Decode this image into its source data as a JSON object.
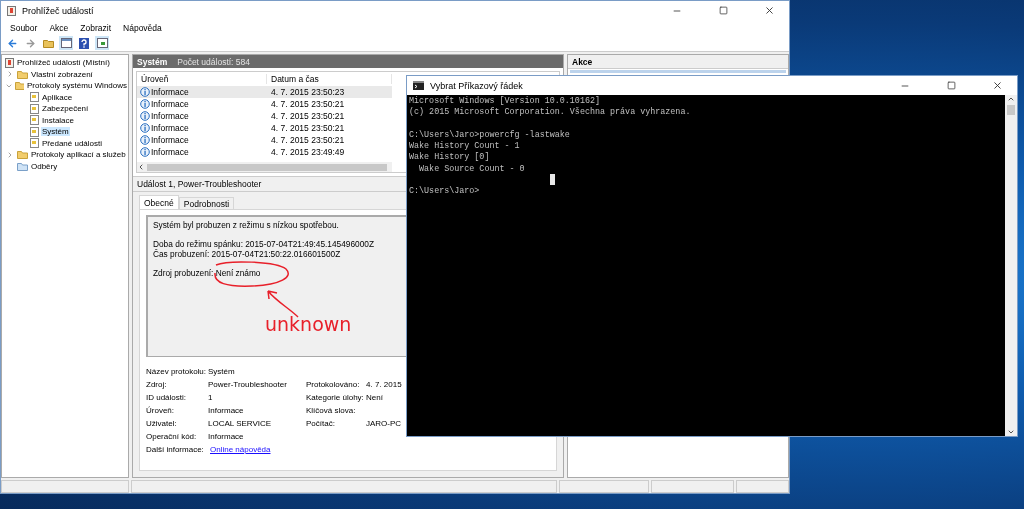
{
  "event_viewer": {
    "title": "Prohlížeč událostí",
    "menu": [
      "Soubor",
      "Akce",
      "Zobrazit",
      "Nápověda"
    ],
    "tree": [
      {
        "label": "Prohlížeč událostí (Místní)",
        "kind": "root",
        "selected": false,
        "children": [
          {
            "label": "Vlastní zobrazení",
            "kind": "folder",
            "expanded": false,
            "selected": false
          },
          {
            "label": "Protokoly systému Windows",
            "kind": "folder",
            "expanded": true,
            "selected": false,
            "children": [
              {
                "label": "Aplikace",
                "kind": "log",
                "selected": false
              },
              {
                "label": "Zabezpečení",
                "kind": "log",
                "selected": false
              },
              {
                "label": "Instalace",
                "kind": "log",
                "selected": false
              },
              {
                "label": "Systém",
                "kind": "log",
                "selected": true
              },
              {
                "label": "Předané události",
                "kind": "log",
                "selected": false
              }
            ]
          },
          {
            "label": "Protokoly aplikací a služeb",
            "kind": "folder",
            "expanded": false,
            "selected": false
          },
          {
            "label": "Odběry",
            "kind": "subscription",
            "selected": false
          }
        ]
      }
    ],
    "log_header": {
      "name": "Systém",
      "count": "Počet událostí: 584"
    },
    "events": {
      "columns": [
        "Úroveň",
        "Datum a čas"
      ],
      "rows": [
        {
          "level": "Informace",
          "time": "4. 7. 2015 23:50:23",
          "selected": true
        },
        {
          "level": "Informace",
          "time": "4. 7. 2015 23:50:21",
          "selected": false
        },
        {
          "level": "Informace",
          "time": "4. 7. 2015 23:50:21",
          "selected": false
        },
        {
          "level": "Informace",
          "time": "4. 7. 2015 23:50:21",
          "selected": false
        },
        {
          "level": "Informace",
          "time": "4. 7. 2015 23:50:21",
          "selected": false
        },
        {
          "level": "Informace",
          "time": "4. 7. 2015 23:49:49",
          "selected": false
        }
      ]
    },
    "detail": {
      "title": "Událost 1, Power-Troubleshooter",
      "tabs": [
        {
          "label": "Obecné",
          "selected": true
        },
        {
          "label": "Podrobnosti",
          "selected": false
        }
      ],
      "message": [
        [
          "Systém byl probuzen z režimu s nízkou spotřebou."
        ],
        [
          "Doba do režimu spánku: 2015-07-04T21:49:45.145496000Z",
          "Čas probuzení: 2015-07-04T21:50:22.016601500Z"
        ],
        [
          "Zdroj probuzení: Není známo"
        ]
      ],
      "annotation": {
        "text": "unknown",
        "color": "#e8202a"
      },
      "properties": [
        {
          "label": "Název protokolu:",
          "value": "Systém",
          "kind": "text"
        },
        {
          "label": "Zdroj:",
          "value": "Power-Troubleshooter",
          "kind": "text",
          "label2": "Protokolováno:",
          "value2": "4. 7. 2015"
        },
        {
          "label": "ID události:",
          "value": "1",
          "kind": "text",
          "label2": "Kategorie úlohy:",
          "value2": "Není"
        },
        {
          "label": "Úroveň:",
          "value": "Informace",
          "kind": "text",
          "label2": "Klíčová slova:"
        },
        {
          "label": "Uživatel:",
          "value": "LOCAL SERVICE",
          "kind": "text",
          "label2": "Počítač:",
          "value2": "JARO-PC"
        },
        {
          "label": "Operační kód:",
          "value": "Informace",
          "kind": "text"
        },
        {
          "label": "Další informace:",
          "value": "Online nápověda",
          "kind": "link"
        }
      ]
    },
    "actions": {
      "title": "Akce"
    }
  },
  "console": {
    "title": "Vybrat Příkazový řádek",
    "paragraphs": [
      [
        "Microsoft Windows [Version 10.0.10162]",
        "(c) 2015 Microsoft Corporation. Všechna práva vyhrazena."
      ],
      [
        "C:\\Users\\Jaro>powercfg -lastwake",
        "Wake History Count - 1",
        "Wake History [0]",
        "  Wake Source Count - 0"
      ],
      [
        "C:\\Users\\Jaro>"
      ]
    ]
  }
}
